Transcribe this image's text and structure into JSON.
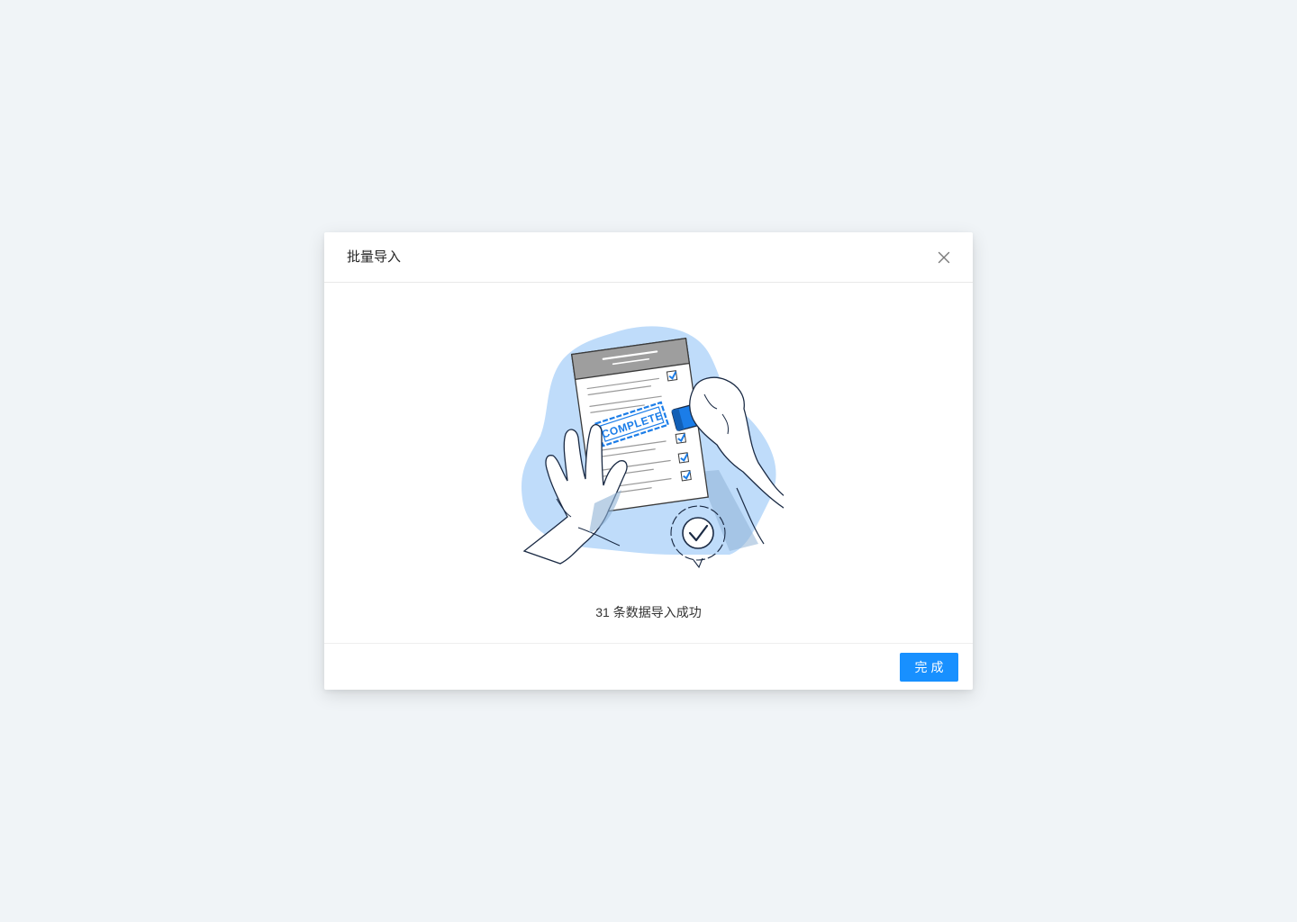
{
  "dialog": {
    "title": "批量导入",
    "close_icon": "close-icon",
    "result_message": "31 条数据导入成功",
    "illustration": {
      "stamp_text": "COMPLETE"
    },
    "done_label": "完成"
  },
  "colors": {
    "page_background": "#f0f4f7",
    "primary": "#1890ff",
    "blob": "#bfdcfa",
    "stamp": "#1b7de8"
  }
}
